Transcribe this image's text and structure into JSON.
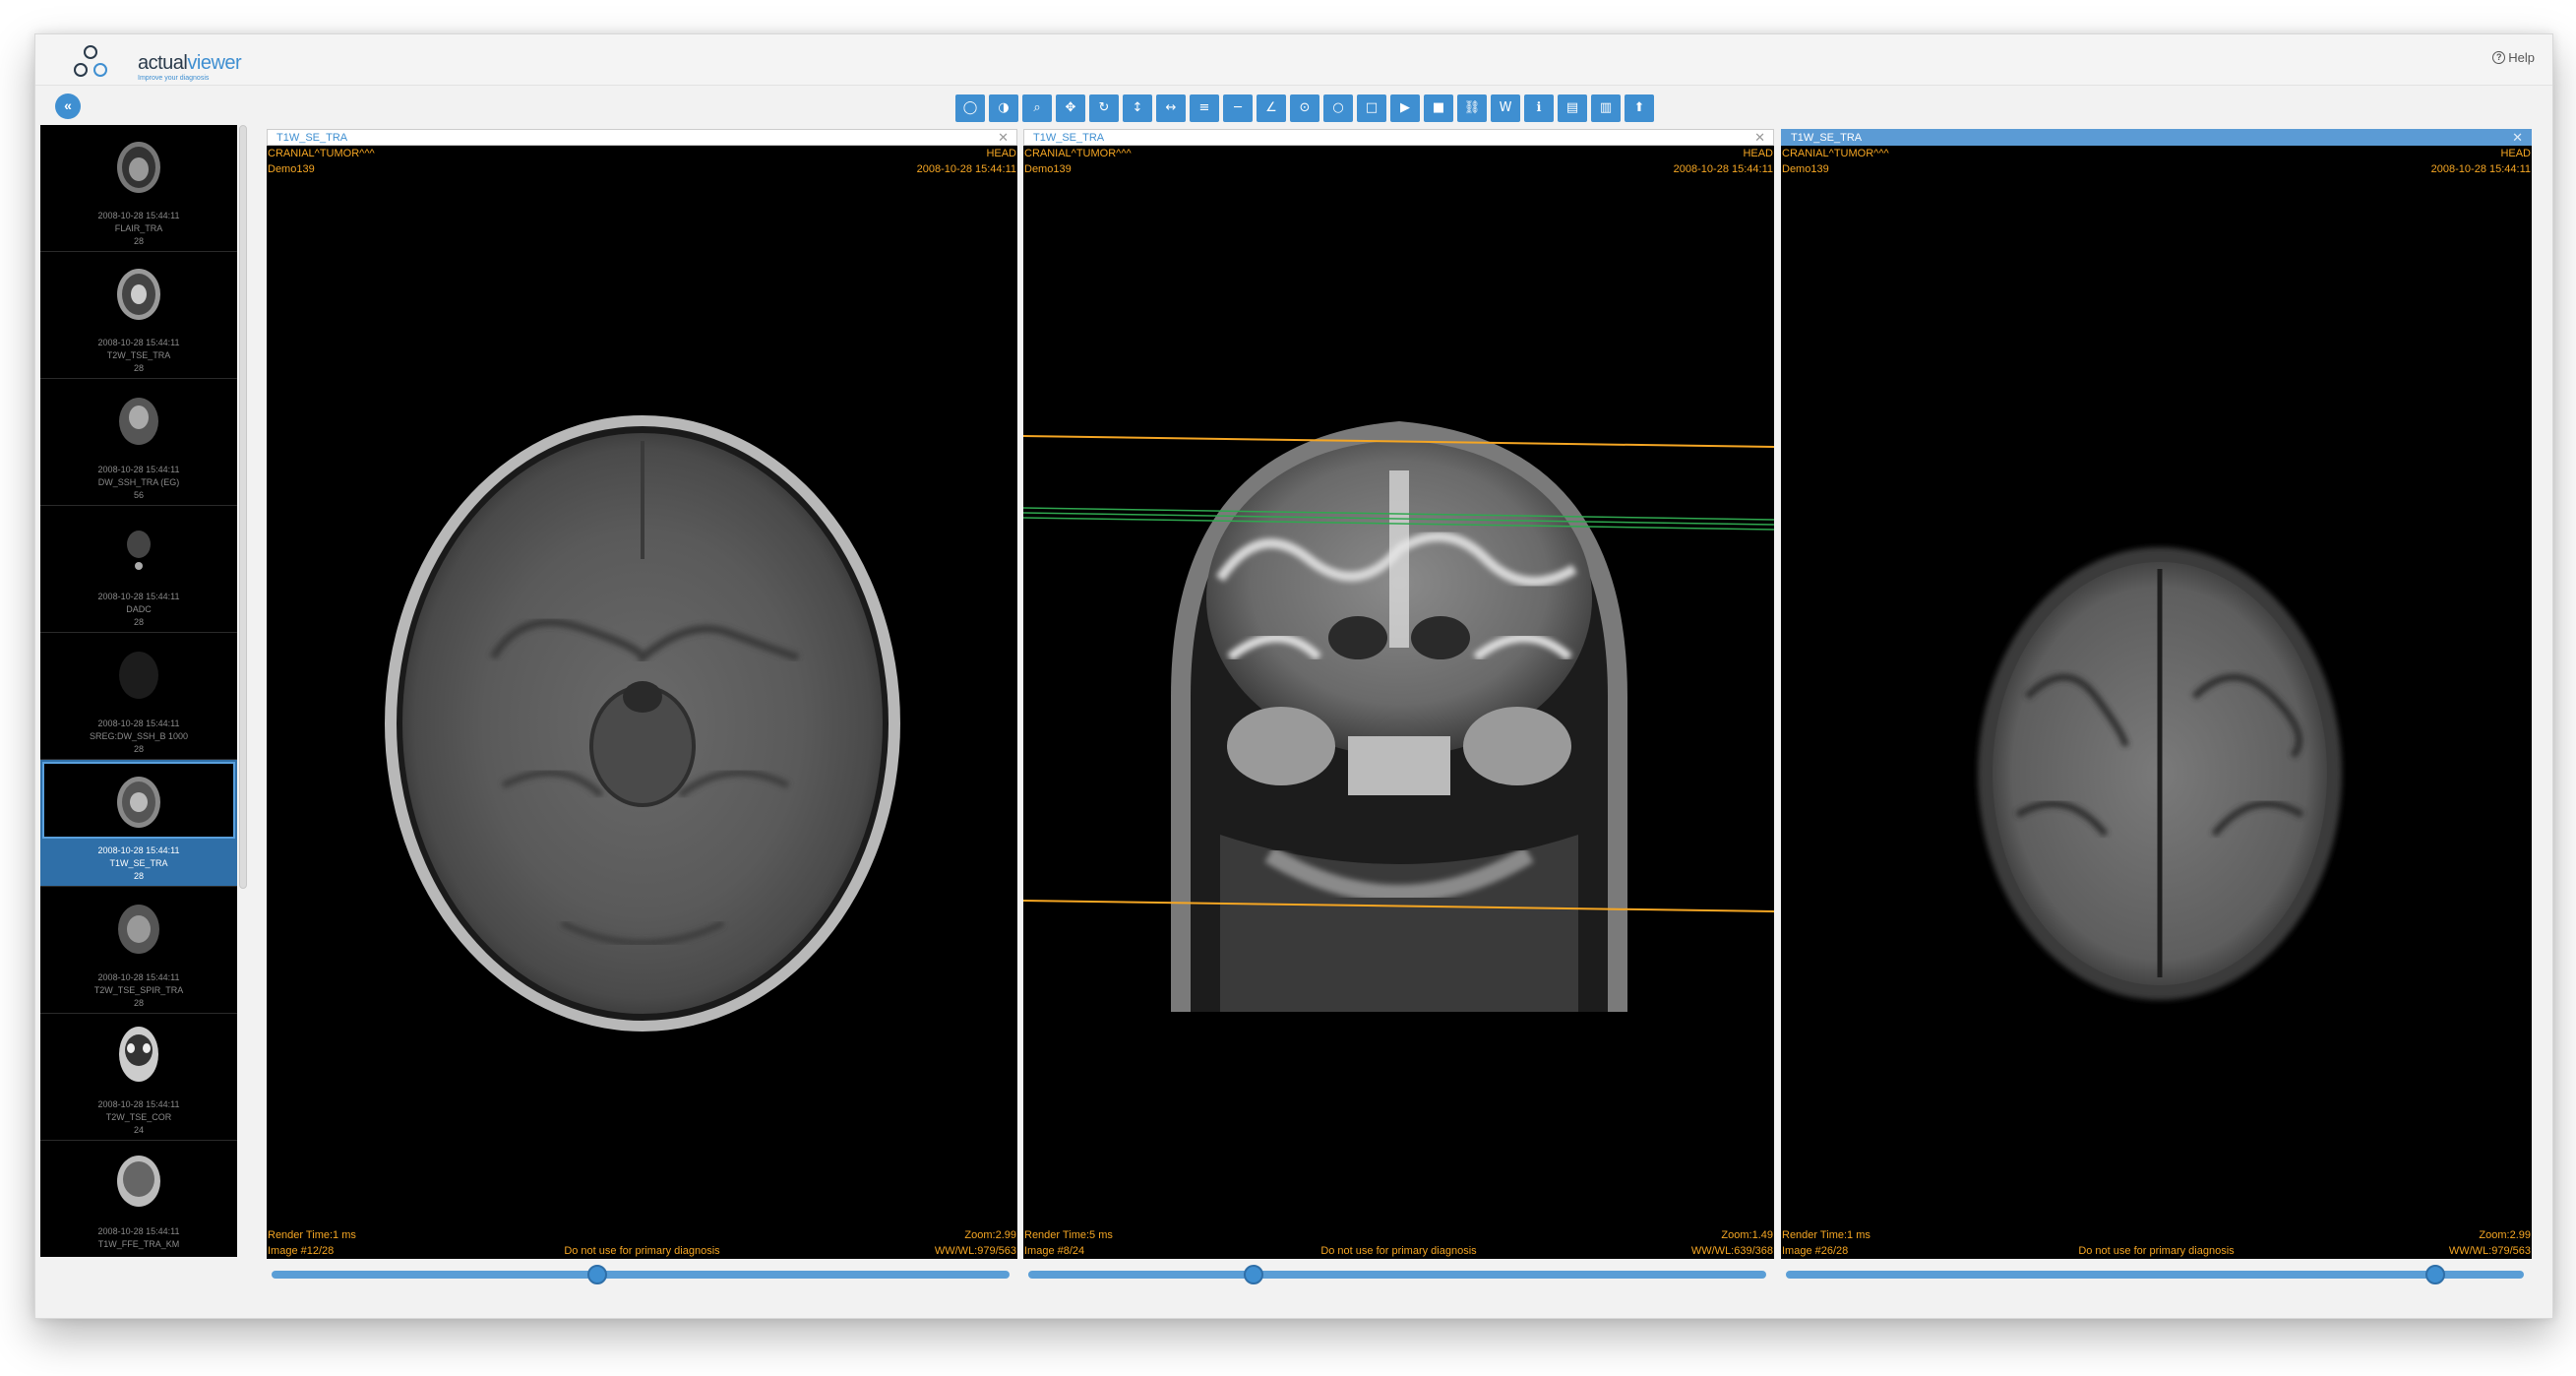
{
  "header": {
    "logo_word_a": "actual",
    "logo_word_b": "viewer",
    "logo_tagline": "Improve your diagnosis",
    "help_label": "Help"
  },
  "toolbar": {
    "buttons": [
      {
        "name": "window-level-icon",
        "glyph": "◯"
      },
      {
        "name": "invert-icon",
        "glyph": "◑"
      },
      {
        "name": "zoom-icon",
        "glyph": "⌕"
      },
      {
        "name": "pan-icon",
        "glyph": "✥"
      },
      {
        "name": "rotate-icon",
        "glyph": "↻"
      },
      {
        "name": "flip-vertical-icon",
        "glyph": "↕"
      },
      {
        "name": "flip-horizontal-icon",
        "glyph": "↔"
      },
      {
        "name": "stack-icon",
        "glyph": "≡"
      },
      {
        "name": "line-measure-icon",
        "glyph": "─"
      },
      {
        "name": "angle-icon",
        "glyph": "∠"
      },
      {
        "name": "ellipse-roi-icon",
        "glyph": "⊙"
      },
      {
        "name": "circle-roi-icon",
        "glyph": "○"
      },
      {
        "name": "rectangle-roi-icon",
        "glyph": "□"
      },
      {
        "name": "play-icon",
        "glyph": "▶"
      },
      {
        "name": "stop-icon",
        "glyph": "■"
      },
      {
        "name": "link-icon",
        "glyph": "⛓"
      },
      {
        "name": "ww-icon",
        "glyph": "W"
      },
      {
        "name": "info-icon",
        "glyph": "ℹ"
      },
      {
        "name": "document-icon",
        "glyph": "▤"
      },
      {
        "name": "report-icon",
        "glyph": "▥"
      },
      {
        "name": "pin-icon",
        "glyph": "⬆"
      }
    ]
  },
  "series": [
    {
      "date": "2008-10-28 15:44:11",
      "name": "FLAIR_TRA",
      "count": "28"
    },
    {
      "date": "2008-10-28 15:44:11",
      "name": "T2W_TSE_TRA",
      "count": "28"
    },
    {
      "date": "2008-10-28 15:44:11",
      "name": "DW_SSH_TRA (EG)",
      "count": "56"
    },
    {
      "date": "2008-10-28 15:44:11",
      "name": "DADC",
      "count": "28"
    },
    {
      "date": "2008-10-28 15:44:11",
      "name": "SREG:DW_SSH_B 1000",
      "count": "28"
    },
    {
      "date": "2008-10-28 15:44:11",
      "name": "T1W_SE_TRA",
      "count": "28",
      "selected": true
    },
    {
      "date": "2008-10-28 15:44:11",
      "name": "T2W_TSE_SPIR_TRA",
      "count": "28"
    },
    {
      "date": "2008-10-28 15:44:11",
      "name": "T2W_TSE_COR",
      "count": "24"
    },
    {
      "date": "2008-10-28 15:44:11",
      "name": "T1W_FFE_TRA_KM",
      "count": ""
    }
  ],
  "viewports": [
    {
      "title": "T1W_SE_TRA",
      "patient": "CRANIAL^TUMOR^^^",
      "patient_id": "Demo139",
      "body_part": "HEAD",
      "datetime": "2008-10-28 15:44:11",
      "render_time": "Render Time:1 ms",
      "image_index": "Image #12/28",
      "disclaimer": "Do not use for primary diagnosis",
      "zoom": "Zoom:2.99",
      "wwwl": "WW/WL:979/563",
      "slider_fraction": 0.44,
      "active": false
    },
    {
      "title": "T1W_SE_TRA",
      "patient": "CRANIAL^TUMOR^^^",
      "patient_id": "Demo139",
      "body_part": "HEAD",
      "datetime": "2008-10-28 15:44:11",
      "render_time": "Render Time:5 ms",
      "image_index": "Image #8/24",
      "disclaimer": "Do not use for primary diagnosis",
      "zoom": "Zoom:1.49",
      "wwwl": "WW/WL:639/368",
      "slider_fraction": 0.3,
      "active": false
    },
    {
      "title": "T1W_SE_TRA",
      "patient": "CRANIAL^TUMOR^^^",
      "patient_id": "Demo139",
      "body_part": "HEAD",
      "datetime": "2008-10-28 15:44:11",
      "render_time": "Render Time:1 ms",
      "image_index": "Image #26/28",
      "disclaimer": "Do not use for primary diagnosis",
      "zoom": "Zoom:2.99",
      "wwwl": "WW/WL:979/563",
      "slider_fraction": 0.89,
      "active": true
    }
  ],
  "colors": {
    "accent": "#3f8fd1",
    "overlay_text": "#f5a623",
    "reference_line_orange": "#f5a623",
    "reference_line_green": "#2fa84f"
  }
}
